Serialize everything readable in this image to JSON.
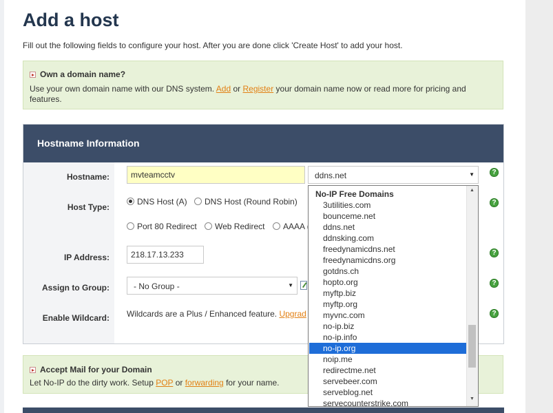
{
  "page": {
    "title": "Add a host",
    "intro": "Fill out the following fields to configure your host. After you are done click 'Create Host' to add your host."
  },
  "own_domain": {
    "heading": "Own a domain name?",
    "text_1": "Use your own domain name with our DNS system.",
    "add_link": "Add",
    "text_or": "or",
    "register_link": "Register",
    "text_2": "your domain name now or read more for pricing and",
    "text_3": "features."
  },
  "hostname_panel": {
    "title": "Hostname Information",
    "labels": {
      "hostname": "Hostname:",
      "host_type": "Host Type:",
      "ip_address": "IP Address:",
      "group": "Assign to Group:",
      "wildcard": "Enable Wildcard:"
    },
    "hostname_value": "mvteamcctv",
    "domain_selected": "ddns.net",
    "host_types": [
      {
        "label": "DNS Host (A)",
        "checked": true
      },
      {
        "label": "DNS Host (Round Robin)",
        "checked": false
      },
      {
        "label": "Port 80 Redirect",
        "checked": false
      },
      {
        "label": "Web Redirect",
        "checked": false
      },
      {
        "label": "AAAA (",
        "checked": false
      }
    ],
    "ip_value": "218.17.13.233",
    "group_value": "- No Group -",
    "wildcard_text": "Wildcards are a Plus / Enhanced feature.",
    "wildcard_link": "Upgrad",
    "help_glyph": "?"
  },
  "domain_dropdown": {
    "group_label": "No-IP Free Domains",
    "options": [
      "3utilities.com",
      "bounceme.net",
      "ddns.net",
      "ddnsking.com",
      "freedynamicdns.net",
      "freedynamicdns.org",
      "gotdns.ch",
      "hopto.org",
      "myftp.biz",
      "myftp.org",
      "myvnc.com",
      "no-ip.biz",
      "no-ip.info",
      "no-ip.org",
      "noip.me",
      "redirectme.net",
      "servebeer.com",
      "serveblog.net",
      "servecounterstrike.com"
    ],
    "highlighted": "no-ip.org"
  },
  "accept_mail": {
    "heading": "Accept Mail for your Domain",
    "text_1": "Let No-IP do the dirty work. Setup",
    "pop_link": "POP",
    "text_or": "or",
    "forwarding_link": "forwarding",
    "text_2": "for your name."
  },
  "colors": {
    "header_bg": "#3c4d68",
    "promo_bg": "#e8f2d9",
    "link": "#e27f12",
    "title": "#23364e",
    "selection": "#1e6dd8",
    "help": "#47a23f"
  }
}
